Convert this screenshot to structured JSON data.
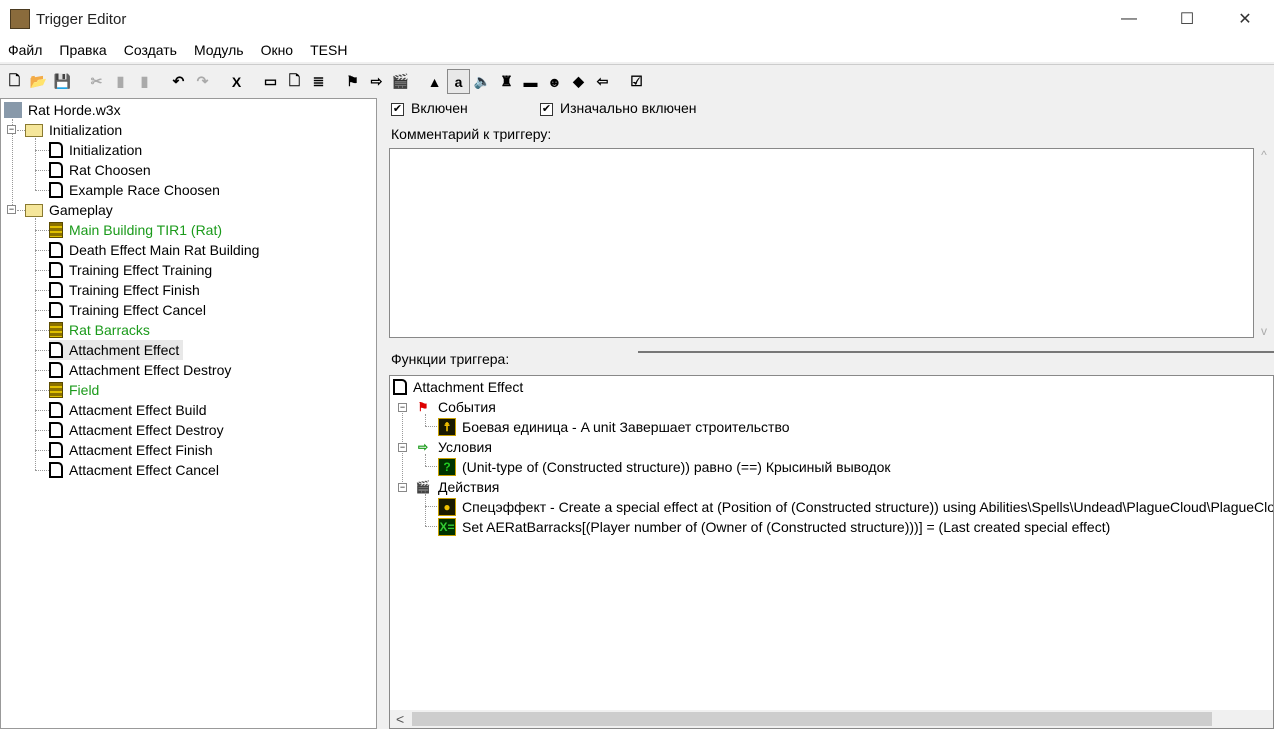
{
  "window": {
    "title": "Trigger Editor",
    "minimize": "—",
    "maximize": "☐",
    "close": "✕"
  },
  "menu": [
    "Файл",
    "Правка",
    "Создать",
    "Модуль",
    "Окно",
    "TESH"
  ],
  "toolbar": [
    {
      "name": "new",
      "g": "🗋"
    },
    {
      "name": "open",
      "g": "📂"
    },
    {
      "name": "save",
      "g": "💾"
    },
    {
      "sep": true
    },
    {
      "name": "cut",
      "g": "✂",
      "dis": true
    },
    {
      "name": "copy",
      "g": "▮",
      "dis": true
    },
    {
      "name": "paste",
      "g": "▮",
      "dis": true
    },
    {
      "sep": true
    },
    {
      "name": "undo",
      "g": "↶"
    },
    {
      "name": "redo",
      "g": "↷",
      "dis": true
    },
    {
      "sep": true
    },
    {
      "name": "delete",
      "g": "X"
    },
    {
      "sep": true
    },
    {
      "name": "new-category",
      "g": "▭"
    },
    {
      "name": "new-trigger",
      "g": "🗋"
    },
    {
      "name": "new-trigger-comment",
      "g": "≣"
    },
    {
      "sep": true
    },
    {
      "name": "new-event",
      "g": "⚑"
    },
    {
      "name": "new-condition",
      "g": "⇨"
    },
    {
      "name": "new-action",
      "g": "🎬"
    },
    {
      "sep": true
    },
    {
      "name": "terrain-editor",
      "g": "▲"
    },
    {
      "name": "trigger-editor",
      "g": "a",
      "pressed": true
    },
    {
      "name": "sound-editor",
      "g": "🔈"
    },
    {
      "name": "object-editor",
      "g": "♜"
    },
    {
      "name": "campaign-editor",
      "g": "▬"
    },
    {
      "name": "ai-editor",
      "g": "☻"
    },
    {
      "name": "import-manager",
      "g": "◆"
    },
    {
      "name": "export",
      "g": "⇦"
    },
    {
      "sep": true
    },
    {
      "name": "test-map",
      "g": "☑"
    }
  ],
  "tree": {
    "root": "Rat Horde.w3x",
    "categories": [
      {
        "label": "Initialization",
        "items": [
          {
            "label": "Initialization",
            "type": "doc"
          },
          {
            "label": "Rat Choosen",
            "type": "doc"
          },
          {
            "label": "Example Race Choosen",
            "type": "doc"
          }
        ]
      },
      {
        "label": "Gameplay",
        "items": [
          {
            "label": "Main Building TIR1 (Rat)",
            "type": "trig"
          },
          {
            "label": "Death Effect Main Rat Building",
            "type": "doc"
          },
          {
            "label": "Training Effect Training",
            "type": "doc"
          },
          {
            "label": "Training Effect Finish",
            "type": "doc"
          },
          {
            "label": "Training Effect Cancel",
            "type": "doc"
          },
          {
            "label": "Rat Barracks",
            "type": "trig"
          },
          {
            "label": "Attachment Effect",
            "type": "doc",
            "selected": true
          },
          {
            "label": "Attachment Effect Destroy",
            "type": "doc"
          },
          {
            "label": "Field",
            "type": "trig"
          },
          {
            "label": "Attacment Effect Build",
            "type": "doc"
          },
          {
            "label": "Attacment Effect Destroy",
            "type": "doc"
          },
          {
            "label": "Attacment Effect Finish",
            "type": "doc"
          },
          {
            "label": "Attacment Effect Cancel",
            "type": "doc"
          }
        ]
      }
    ]
  },
  "trigger": {
    "enabled_label": "Включен",
    "enabled": true,
    "initially_on_label": "Изначально включен",
    "initially_on": true,
    "comment_label": "Комментарий к триггеру:",
    "comment": "",
    "functions_label": "Функции триггера:",
    "name": "Attachment Effect",
    "events_label": "События",
    "event": "Боевая единица - A unit Завершает строительство",
    "conditions_label": "Условия",
    "condition": "(Unit-type of (Constructed structure)) равно (==) Крысиный выводок",
    "actions_label": "Действия",
    "actions": [
      "Спецэффект - Create a special effect at (Position of (Constructed structure)) using Abilities\\Spells\\Undead\\PlagueCloud\\PlagueCloudCaster.mdl",
      "Set AERatBarracks[(Player number of (Owner of (Constructed structure)))] = (Last created special effect)"
    ]
  },
  "scroll": {
    "left": "<",
    "up": "^",
    "down": "v"
  }
}
